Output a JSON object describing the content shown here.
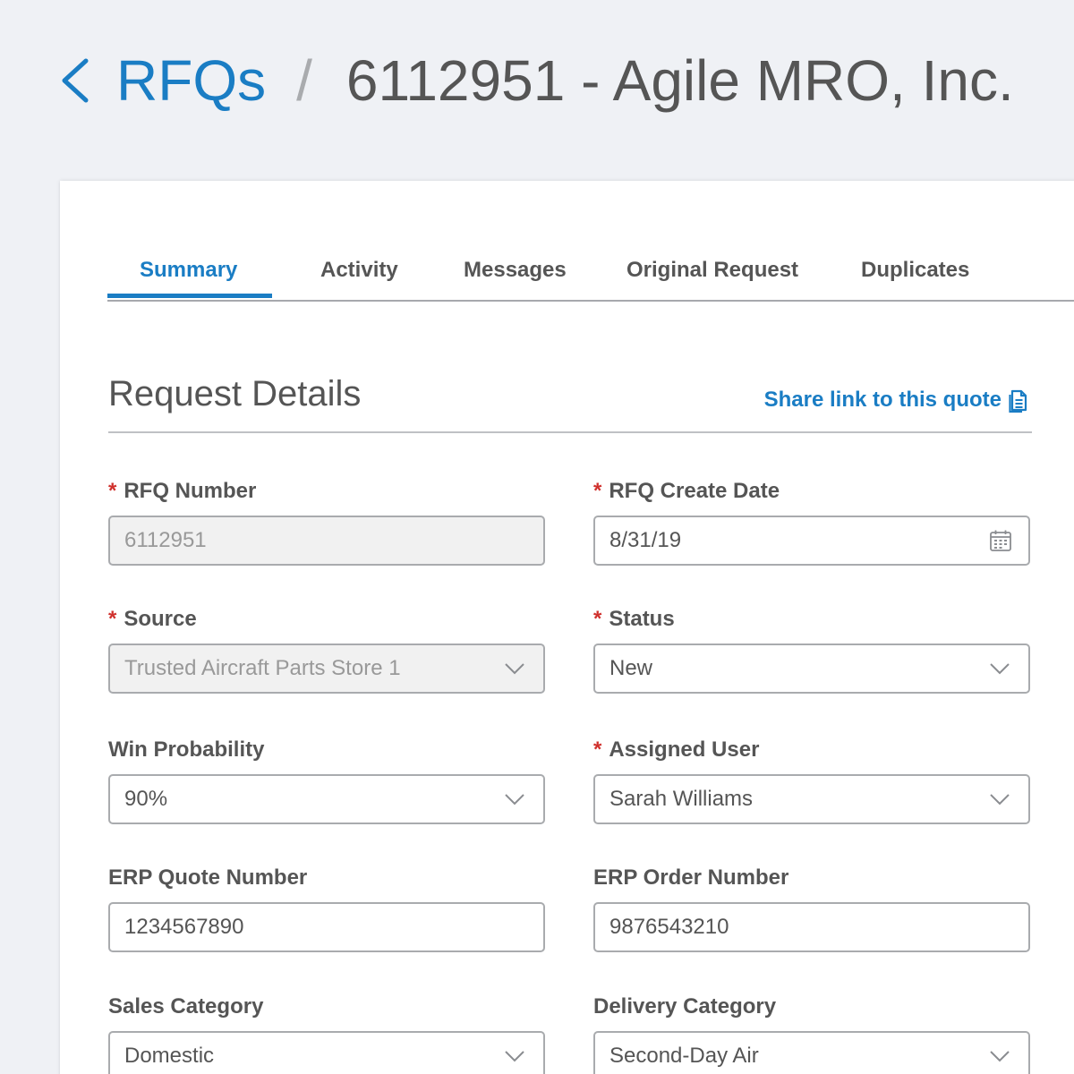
{
  "header": {
    "back_label": "RFQs",
    "separator": "/",
    "title": "6112951 - Agile MRO, Inc."
  },
  "tabs": [
    {
      "label": "Summary",
      "active": true
    },
    {
      "label": "Activity",
      "active": false
    },
    {
      "label": "Messages",
      "active": false
    },
    {
      "label": "Original Request",
      "active": false
    },
    {
      "label": "Duplicates",
      "active": false
    }
  ],
  "section": {
    "title": "Request Details",
    "share_link": "Share link to this quote"
  },
  "fields": {
    "rfq_number": {
      "label": "RFQ Number",
      "required": true,
      "value": "6112951",
      "type": "text",
      "disabled": true
    },
    "rfq_create_date": {
      "label": "RFQ Create Date",
      "required": true,
      "value": "8/31/19",
      "type": "date",
      "icon": "calendar-icon"
    },
    "source": {
      "label": "Source",
      "required": true,
      "value": "Trusted Aircraft Parts Store 1",
      "type": "select",
      "disabled": true
    },
    "status": {
      "label": "Status",
      "required": true,
      "value": "New",
      "type": "select"
    },
    "win_probability": {
      "label": "Win Probability",
      "required": false,
      "value": "90%",
      "type": "select"
    },
    "assigned_user": {
      "label": "Assigned User",
      "required": true,
      "value": "Sarah Williams",
      "type": "select"
    },
    "erp_quote_number": {
      "label": "ERP Quote Number",
      "required": false,
      "value": "1234567890",
      "type": "text"
    },
    "erp_order_number": {
      "label": "ERP Order Number",
      "required": false,
      "value": "9876543210",
      "type": "text"
    },
    "sales_category": {
      "label": "Sales Category",
      "required": false,
      "value": "Domestic",
      "type": "select"
    },
    "delivery_category": {
      "label": "Delivery Category",
      "required": false,
      "value": "Second-Day Air",
      "type": "select"
    }
  },
  "required_marker": "*",
  "colors": {
    "accent": "#1a7dc4",
    "required": "#d0312d",
    "page_background": "#eff1f5",
    "text": "#555555"
  }
}
